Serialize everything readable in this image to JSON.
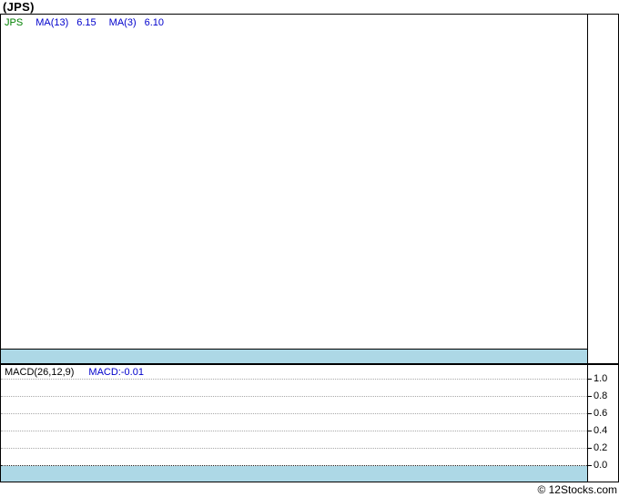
{
  "page": {
    "title": "(JPS)",
    "copyright": "© 12Stocks.com"
  },
  "colors": {
    "band_blue": "#add8e6",
    "legend_blue": "#0000cc",
    "symbol_green": "#008000",
    "grid_gray": "#a8a8a8",
    "border_black": "#000000"
  },
  "main_chart": {
    "legend": {
      "symbol": "JPS",
      "ma13_label": "MA(13)",
      "ma13_value": "6.15",
      "ma3_label": "MA(3)",
      "ma3_value": "6.10"
    }
  },
  "macd_panel": {
    "indicator_label": "MACD(26,12,9)",
    "indicator_value": "MACD:-0.01",
    "axis_ticks": [
      "1.0",
      "0.8",
      "0.6",
      "0.4",
      "0.2",
      "0.0"
    ]
  },
  "chart_data": [
    {
      "type": "line",
      "title": "(JPS)",
      "series": [
        {
          "name": "JPS",
          "color": "#008000",
          "values": []
        },
        {
          "name": "MA(13)",
          "color": "#0000cc",
          "last_value": 6.15
        },
        {
          "name": "MA(3)",
          "color": "#0000cc",
          "last_value": 6.1
        }
      ],
      "legend_position": "top-left",
      "note": "price panel is blank; only legend values visible; light blue volume strip at bottom of panel"
    },
    {
      "type": "line",
      "title": "MACD(26,12,9)",
      "series": [
        {
          "name": "MACD",
          "last_value": -0.01,
          "values": []
        }
      ],
      "yticks": [
        1.0,
        0.8,
        0.6,
        0.4,
        0.2,
        0.0
      ],
      "ylim": [
        0.0,
        1.0
      ],
      "grid": "horizontal dotted lines, zero line darker",
      "legend_position": "top-left",
      "note": "MACD panel is blank; light blue strip below the 0.0 line"
    }
  ]
}
